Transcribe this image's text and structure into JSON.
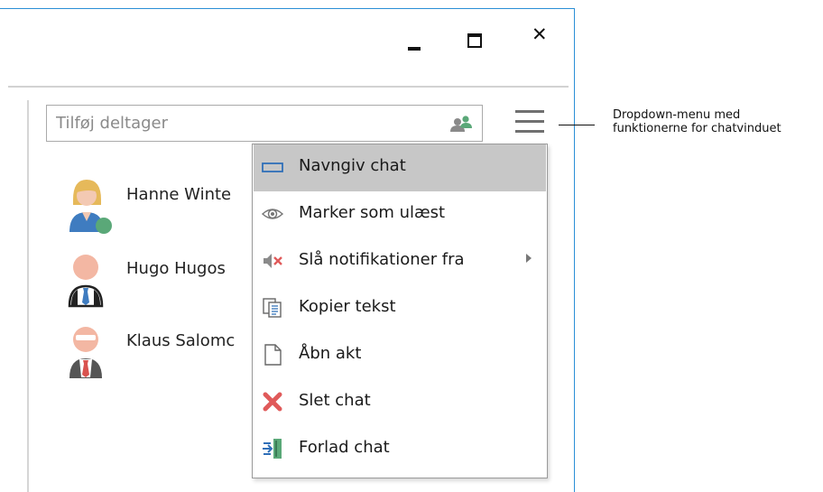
{
  "search": {
    "placeholder": "Tilføj deltager"
  },
  "participants": [
    {
      "name": "Hanne Winte"
    },
    {
      "name": "Hugo Hugos"
    },
    {
      "name": "Klaus Salomc"
    }
  ],
  "menu": {
    "items": [
      {
        "label": "Navngiv chat",
        "icon": "rename-icon"
      },
      {
        "label": "Marker som ulæst",
        "icon": "eye-icon"
      },
      {
        "label": "Slå notifikationer fra",
        "icon": "mute-icon"
      },
      {
        "label": "Kopier tekst",
        "icon": "copy-icon"
      },
      {
        "label": "Åbn akt",
        "icon": "document-icon"
      },
      {
        "label": "Slet chat",
        "icon": "delete-icon"
      },
      {
        "label": "Forlad chat",
        "icon": "leave-icon"
      }
    ]
  },
  "annotation": {
    "line1": "Dropdown-menu med",
    "line2": "funktionerne for chatvinduet"
  },
  "colors": {
    "window_border": "#2b8fd6",
    "menu_highlight": "#c7c7c7",
    "delete_red": "#e05a5a",
    "status_green": "#5aa878"
  }
}
